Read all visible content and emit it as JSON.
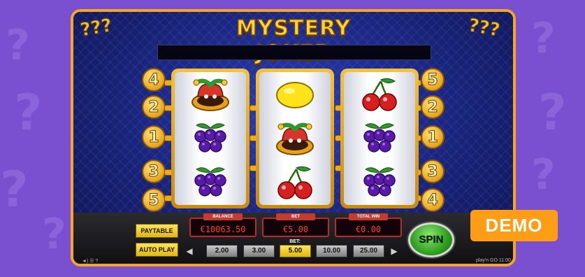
{
  "game": {
    "title": "MYSTERY JOKER",
    "corner_marks": "???"
  },
  "reels": [
    [
      "joker",
      "grapes",
      "grapes"
    ],
    [
      "lemon",
      "joker",
      "cherries"
    ],
    [
      "cherries",
      "grapes",
      "grapes"
    ]
  ],
  "paylines": {
    "left": [
      "4",
      "2",
      "1",
      "3",
      "5"
    ],
    "right": [
      "5",
      "2",
      "1",
      "3",
      "4"
    ]
  },
  "displays": {
    "balance_label": "BALANCE",
    "balance_value": "€10063.50",
    "bet_label": "BET",
    "bet_value": "€5.00",
    "win_label": "TOTAL WIN",
    "win_value": "€0.00"
  },
  "buttons": {
    "paytable": "PAYTABLE",
    "autoplay": "AUTO PLAY",
    "spin": "SPIN",
    "bet_prev": "◀",
    "bet_next": "▶"
  },
  "bet_selector": {
    "label": "BET:",
    "options": [
      "2.00",
      "3.00",
      "5.00",
      "10.00",
      "25.00"
    ],
    "selected": "5.00"
  },
  "footer": {
    "clock": "11:00",
    "brand": "play'n GO"
  },
  "overlay": {
    "demo": "DEMO"
  },
  "colors": {
    "frame": "#f6a623",
    "background": "#7a4fd0",
    "demo_badge": "#ff9e16",
    "display_text": "#ff3b2b"
  }
}
